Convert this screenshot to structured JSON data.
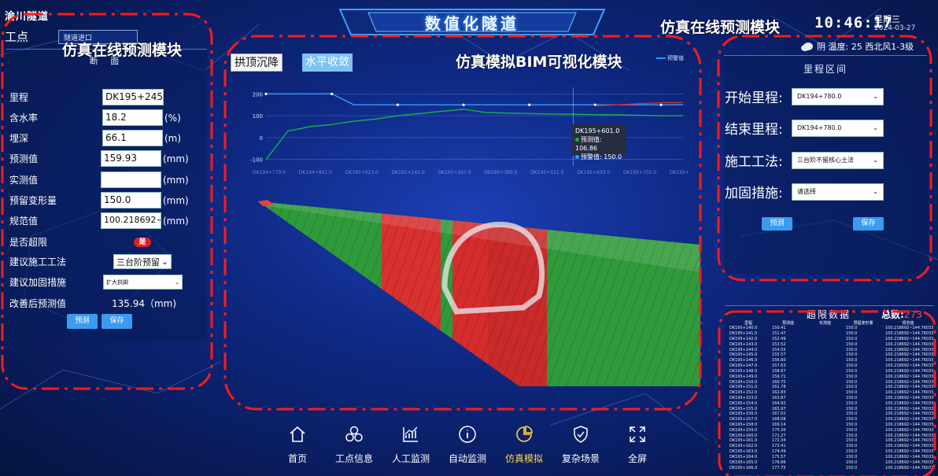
{
  "header": {
    "logo_text": "渝川隧道",
    "title": "数值化隧道",
    "time": "10:46:17",
    "weekday": "星期三",
    "date": "2024-03-27",
    "weather": "阴 温度: 25 西北风1-3级"
  },
  "annotations": {
    "left_module": "仿真在线预测模块",
    "top_right_module": "仿真在线预测模块",
    "center_module": "仿真模拟BIM可视化模块"
  },
  "left_panel": {
    "site_label": "工点",
    "site_select": "隧道进口",
    "section_title": "断 面",
    "fields": [
      {
        "label": "里程",
        "value": "DK195+245.0",
        "unit": ""
      },
      {
        "label": "含水率",
        "value": "18.2",
        "unit": "(%)"
      },
      {
        "label": "埋深",
        "value": "66.1",
        "unit": "(m)"
      },
      {
        "label": "预测值",
        "value": "159.93",
        "unit": "(mm)"
      },
      {
        "label": "实测值",
        "value": "",
        "unit": "(mm)"
      },
      {
        "label": "预留变形量",
        "value": "150.0",
        "unit": "(mm)"
      },
      {
        "label": "规范值",
        "value": "100.218692~1(",
        "unit": "(mm)"
      }
    ],
    "over_limit_label": "是否超限",
    "over_limit_value": "是",
    "method_label": "建议施工工法",
    "method_value": "三台阶预留",
    "reinforce_label": "建议加固措施",
    "reinforce_value": "扩大拱脚",
    "improved_label": "改善后预测值",
    "improved_value": "135.94（mm)",
    "predict_btn": "预测",
    "save_btn": "保存"
  },
  "center": {
    "tab_crown": "拱顶沉降",
    "tab_convergence": "水平收敛",
    "legend_label": "预警值",
    "tooltip": {
      "title": "DK195+601.0",
      "measured": "预测值: 106.86",
      "warning": "预警值: 150.0"
    }
  },
  "chart_data": {
    "type": "line",
    "ytick_labels": [
      "200",
      "100",
      "0",
      "-100"
    ],
    "ylim": [
      -130,
      230
    ],
    "x_ticks": [
      "DK194+779.0",
      "DK194+901.0",
      "DK195+023.0",
      "DK195+145.0",
      "DK195+267.0",
      "DK195+389.0",
      "DK195+511.0",
      "DK195+633.0",
      "DK195+755.0",
      "DK195+877.0"
    ],
    "series": [
      {
        "name": "预警值",
        "color": "#2fa0ff",
        "values": [
          200,
          200,
          200,
          200,
          150,
          150,
          150,
          150,
          150,
          150,
          150,
          150,
          150,
          150,
          150,
          150,
          150,
          150,
          150,
          150
        ]
      },
      {
        "name": "预测值",
        "color": "#17b34a",
        "values": [
          -100,
          30,
          50,
          60,
          75,
          85,
          100,
          110,
          120,
          130,
          115,
          112,
          110,
          108,
          106.86,
          105,
          104,
          102,
          100,
          100
        ]
      },
      {
        "name": "",
        "color": "#e02828",
        "values": [
          null,
          null,
          null,
          null,
          null,
          null,
          null,
          null,
          null,
          null,
          null,
          null,
          null,
          null,
          null,
          145,
          150,
          155,
          160,
          160
        ]
      }
    ]
  },
  "nav": [
    {
      "label": "首页",
      "icon": "home-icon"
    },
    {
      "label": "工点信息",
      "icon": "nodes-icon"
    },
    {
      "label": "人工监测",
      "icon": "chart-up-icon"
    },
    {
      "label": "自动监测",
      "icon": "info-icon"
    },
    {
      "label": "仿真模拟",
      "icon": "pie-icon",
      "active": true
    },
    {
      "label": "复杂场景",
      "icon": "shield-icon"
    },
    {
      "label": "全屏",
      "icon": "expand-icon"
    }
  ],
  "right_panel": {
    "title": "里程区间",
    "start_label": "开始里程:",
    "start_value": "DK194+780.0",
    "end_label": "结束里程:",
    "end_value": "DK194+780.0",
    "method_label": "施工工法:",
    "method_value": "三台阶不留核心土法",
    "reinforce_label": "加固措施:",
    "reinforce_value": "请选择",
    "predict_btn": "预测",
    "save_btn": "保存"
  },
  "over_table": {
    "title": "超限数据",
    "total_label": "总数:",
    "total_value": "273",
    "headers": [
      "里程",
      "预测值",
      "实测值",
      "预留变形量",
      "规范值"
    ],
    "rows": [
      [
        "DK195+140.0",
        "150.41",
        "",
        "150.0",
        "100.218692~144.760332"
      ],
      [
        "DK195+141.0",
        "151.47",
        "",
        "150.0",
        "100.218692~144.760332"
      ],
      [
        "DK195+142.0",
        "152.49",
        "",
        "150.0",
        "100.218692~144.760332"
      ],
      [
        "DK195+143.0",
        "153.52",
        "",
        "150.0",
        "100.218692~144.760332"
      ],
      [
        "DK195+144.0",
        "154.55",
        "",
        "150.0",
        "100.218692~144.760332"
      ],
      [
        "DK195+145.0",
        "155.57",
        "",
        "150.0",
        "100.218692~144.760332"
      ],
      [
        "DK195+146.0",
        "156.60",
        "",
        "150.0",
        "100.218692~144.760332"
      ],
      [
        "DK195+147.0",
        "157.63",
        "",
        "150.0",
        "100.218692~144.760332"
      ],
      [
        "DK195+148.0",
        "158.67",
        "",
        "150.0",
        "100.218692~144.760332"
      ],
      [
        "DK195+149.0",
        "159.71",
        "",
        "150.0",
        "100.218692~144.760332"
      ],
      [
        "DK195+150.0",
        "160.75",
        "",
        "150.0",
        "100.218692~144.760332"
      ],
      [
        "DK195+151.0",
        "161.78",
        "",
        "150.0",
        "100.218692~144.760332"
      ],
      [
        "DK195+152.0",
        "162.83",
        "",
        "150.0",
        "100.218692~144.760332"
      ],
      [
        "DK195+153.0",
        "163.87",
        "",
        "150.0",
        "100.218692~144.760332"
      ],
      [
        "DK195+154.0",
        "164.92",
        "",
        "150.0",
        "100.218692~144.760332"
      ],
      [
        "DK195+155.0",
        "165.97",
        "",
        "150.0",
        "100.218692~144.760332"
      ],
      [
        "DK195+156.0",
        "167.02",
        "",
        "150.0",
        "100.218692~144.760332"
      ],
      [
        "DK195+157.0",
        "168.08",
        "",
        "150.0",
        "100.218692~144.760332"
      ],
      [
        "DK195+158.0",
        "169.14",
        "",
        "150.0",
        "100.218692~144.760332"
      ],
      [
        "DK195+159.0",
        "170.20",
        "",
        "150.0",
        "100.218692~144.760332"
      ],
      [
        "DK195+160.0",
        "171.27",
        "",
        "150.0",
        "100.218692~144.760332"
      ],
      [
        "DK195+161.0",
        "172.34",
        "",
        "150.0",
        "100.218692~144.760332"
      ],
      [
        "DK195+162.0",
        "173.41",
        "",
        "150.0",
        "100.218692~144.760332"
      ],
      [
        "DK195+163.0",
        "174.49",
        "",
        "150.0",
        "100.218692~144.760332"
      ],
      [
        "DK195+164.0",
        "175.57",
        "",
        "150.0",
        "100.218692~144.760332"
      ],
      [
        "DK195+165.0",
        "176.66",
        "",
        "150.0",
        "100.218692~144.760332"
      ],
      [
        "DK195+166.0",
        "177.75",
        "",
        "150.0",
        "100.218692~144.760332"
      ]
    ]
  }
}
